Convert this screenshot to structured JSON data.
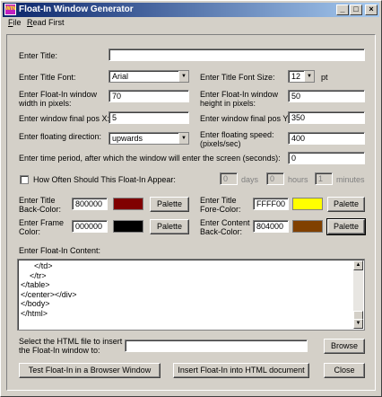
{
  "window": {
    "title": "Float-In Window Generator",
    "icon_label": "WIN",
    "controls": {
      "minimize": "_",
      "maximize": "□",
      "close": "×"
    }
  },
  "menu": [
    {
      "label": "File"
    },
    {
      "label": "Read First"
    }
  ],
  "form": {
    "title": {
      "label": "Enter Title:",
      "value": ""
    },
    "font": {
      "label": "Enter Title Font:",
      "value": "Arial"
    },
    "font_size": {
      "label": "Enter Title Font Size:",
      "value": "12",
      "unit": "pt"
    },
    "width": {
      "label": "Enter Float-In window width in pixels:",
      "value": "70"
    },
    "height": {
      "label": "Enter Float-In window height in pixels:",
      "value": "50"
    },
    "pos_x": {
      "label": "Enter window final pos X:",
      "value": "5"
    },
    "pos_y": {
      "label": "Enter window final pos Y:",
      "value": "350"
    },
    "direction": {
      "label": "Enter floating direction:",
      "value": "upwards"
    },
    "speed": {
      "label": "Enter floating speed: (pixels/sec)",
      "value": "400"
    },
    "period": {
      "label": "Enter time period, after which the window will enter the screen (seconds):",
      "value": "0"
    },
    "how_often": {
      "label": "How Often Should This Float-In Appear:",
      "days": {
        "value": "0",
        "unit": "days"
      },
      "hours": {
        "value": "0",
        "unit": "hours"
      },
      "minutes": {
        "value": "1",
        "unit": "minutes"
      }
    },
    "title_back": {
      "label": "Enter Title Back-Color:",
      "value": "800000",
      "color": "#800000",
      "button": "Palette"
    },
    "title_fore": {
      "label": "Enter Title Fore-Color:",
      "value": "FFFF00",
      "color": "#FFFF00",
      "button": "Palette"
    },
    "frame_color": {
      "label": "Enter Frame Color:",
      "value": "000000",
      "color": "#000000",
      "button": "Palette"
    },
    "content_back": {
      "label": "Enter Content Back-Color:",
      "value": "804000",
      "color": "#804000",
      "button": "Palette"
    },
    "content": {
      "label": "Enter Float-In Content:",
      "text": "      </td>\n    </tr>\n</table>\n</center></div>\n</body>\n</html>"
    },
    "html_file": {
      "label": "Select the HTML file to insert the Float-In window to:",
      "value": "",
      "button": "Browse"
    }
  },
  "actions": {
    "test": "Test Float-In in a Browser Window",
    "insert": "Insert Float-In into HTML document",
    "close": "Close"
  }
}
